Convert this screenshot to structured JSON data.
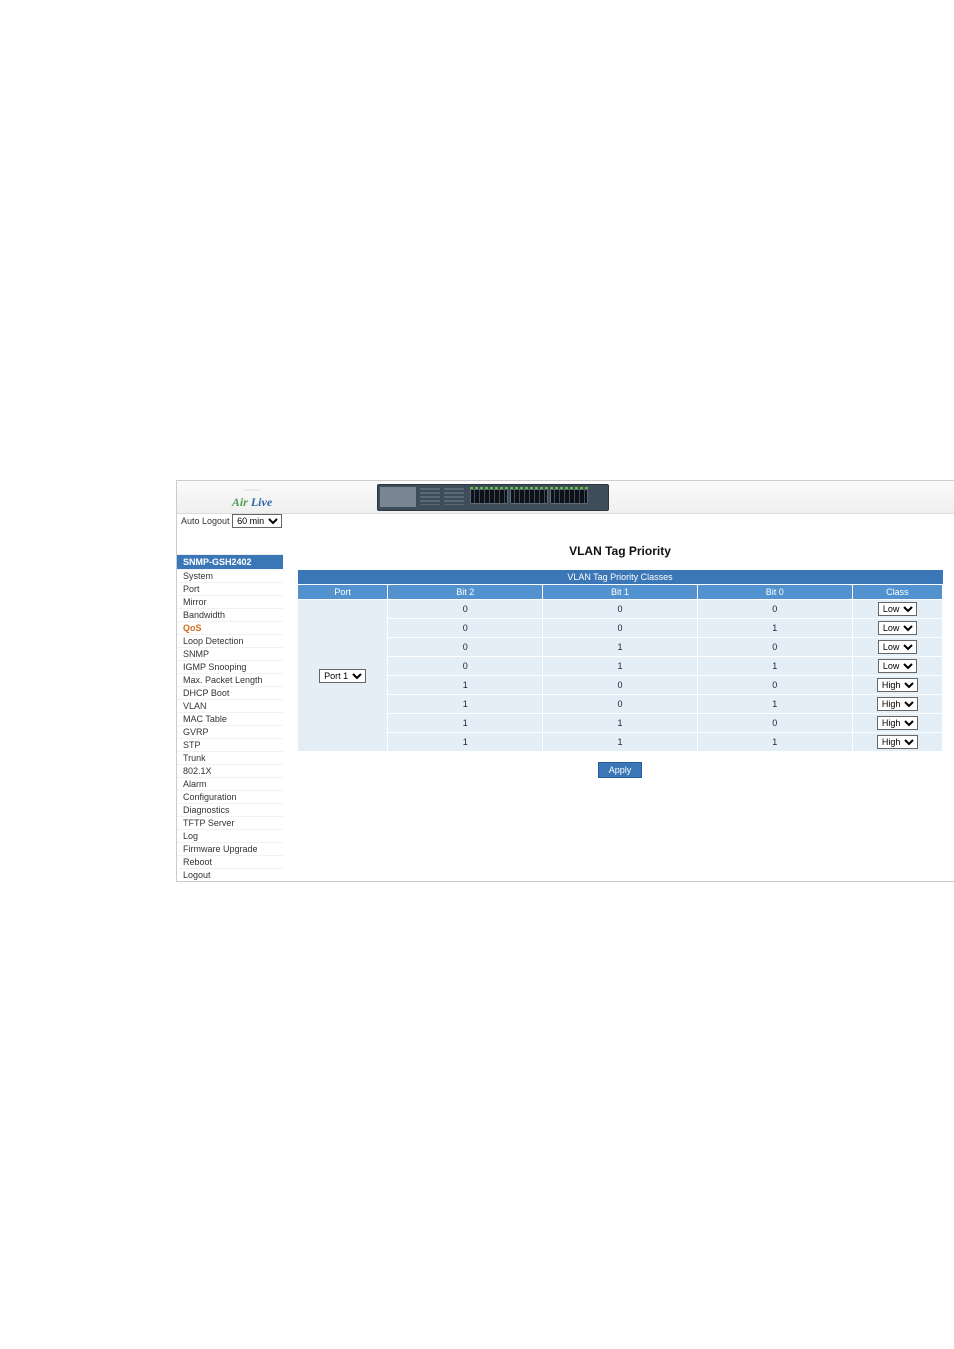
{
  "logo": {
    "brand_a": "Air",
    "brand_b": " Live"
  },
  "auto_logout": {
    "label": "Auto Logout",
    "value": "60 min"
  },
  "side": {
    "title": "SNMP-GSH2402",
    "items": [
      {
        "label": "System"
      },
      {
        "label": "Port"
      },
      {
        "label": "Mirror"
      },
      {
        "label": "Bandwidth"
      },
      {
        "label": "QoS",
        "current": true
      },
      {
        "label": "Loop Detection"
      },
      {
        "label": "SNMP"
      },
      {
        "label": "IGMP Snooping"
      },
      {
        "label": "Max. Packet Length"
      },
      {
        "label": "DHCP Boot"
      },
      {
        "label": "VLAN"
      },
      {
        "label": "MAC Table"
      },
      {
        "label": "GVRP"
      },
      {
        "label": "STP"
      },
      {
        "label": "Trunk"
      },
      {
        "label": "802.1X"
      },
      {
        "label": "Alarm"
      },
      {
        "label": "Configuration"
      },
      {
        "label": "Diagnostics"
      },
      {
        "label": "TFTP Server"
      },
      {
        "label": "Log"
      },
      {
        "label": "Firmware Upgrade"
      },
      {
        "label": "Reboot"
      },
      {
        "label": "Logout"
      }
    ]
  },
  "page_title": "VLAN Tag Priority",
  "table": {
    "caption": "VLAN Tag Priority Classes",
    "headers": {
      "port": "Port",
      "bit2": "Bit 2",
      "bit1": "Bit 1",
      "bit0": "Bit 0",
      "class": "Class"
    },
    "port_value": "Port 1",
    "rows": [
      {
        "b2": "0",
        "b1": "0",
        "b0": "0",
        "class": "Low"
      },
      {
        "b2": "0",
        "b1": "0",
        "b0": "1",
        "class": "Low"
      },
      {
        "b2": "0",
        "b1": "1",
        "b0": "0",
        "class": "Low"
      },
      {
        "b2": "0",
        "b1": "1",
        "b0": "1",
        "class": "Low"
      },
      {
        "b2": "1",
        "b1": "0",
        "b0": "0",
        "class": "High"
      },
      {
        "b2": "1",
        "b1": "0",
        "b0": "1",
        "class": "High"
      },
      {
        "b2": "1",
        "b1": "1",
        "b0": "0",
        "class": "High"
      },
      {
        "b2": "1",
        "b1": "1",
        "b0": "1",
        "class": "High"
      }
    ]
  },
  "apply_label": "Apply"
}
